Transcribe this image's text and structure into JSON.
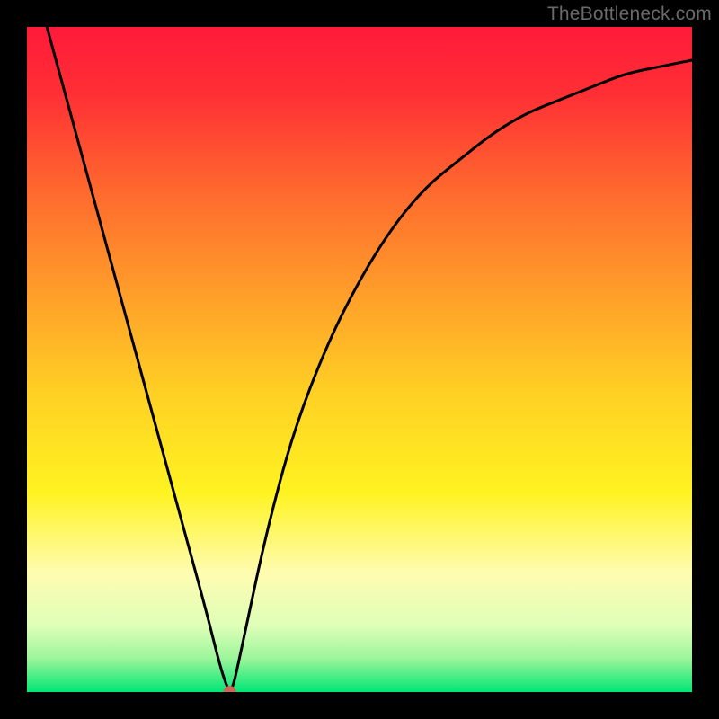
{
  "attribution": "TheBottleneck.com",
  "chart_data": {
    "type": "line",
    "title": "",
    "xlabel": "",
    "ylabel": "",
    "xlim": [
      0,
      1
    ],
    "ylim": [
      0,
      1
    ],
    "gradient_stops": [
      {
        "offset": 0.0,
        "color": "#ff1a3a"
      },
      {
        "offset": 0.1,
        "color": "#ff2f35"
      },
      {
        "offset": 0.25,
        "color": "#ff6a2e"
      },
      {
        "offset": 0.4,
        "color": "#ff9e2a"
      },
      {
        "offset": 0.55,
        "color": "#ffd024"
      },
      {
        "offset": 0.7,
        "color": "#fff321"
      },
      {
        "offset": 0.82,
        "color": "#fffcb0"
      },
      {
        "offset": 0.9,
        "color": "#dfffb8"
      },
      {
        "offset": 0.95,
        "color": "#9bf59a"
      },
      {
        "offset": 1.0,
        "color": "#00e676"
      }
    ],
    "series": [
      {
        "name": "bottleneck-curve",
        "x": [
          0.03,
          0.06,
          0.09,
          0.12,
          0.15,
          0.18,
          0.21,
          0.24,
          0.27,
          0.29,
          0.3,
          0.305,
          0.31,
          0.315,
          0.33,
          0.36,
          0.4,
          0.45,
          0.5,
          0.55,
          0.6,
          0.65,
          0.7,
          0.75,
          0.8,
          0.85,
          0.9,
          0.95,
          1.0
        ],
        "y": [
          1.0,
          0.89,
          0.78,
          0.67,
          0.56,
          0.45,
          0.34,
          0.23,
          0.12,
          0.04,
          0.01,
          0.0,
          0.01,
          0.03,
          0.1,
          0.24,
          0.39,
          0.52,
          0.62,
          0.7,
          0.76,
          0.8,
          0.84,
          0.87,
          0.89,
          0.91,
          0.93,
          0.94,
          0.95
        ]
      }
    ],
    "marker": {
      "x": 0.305,
      "y": 0.0,
      "color": "#cc6655",
      "radius": 7
    }
  }
}
